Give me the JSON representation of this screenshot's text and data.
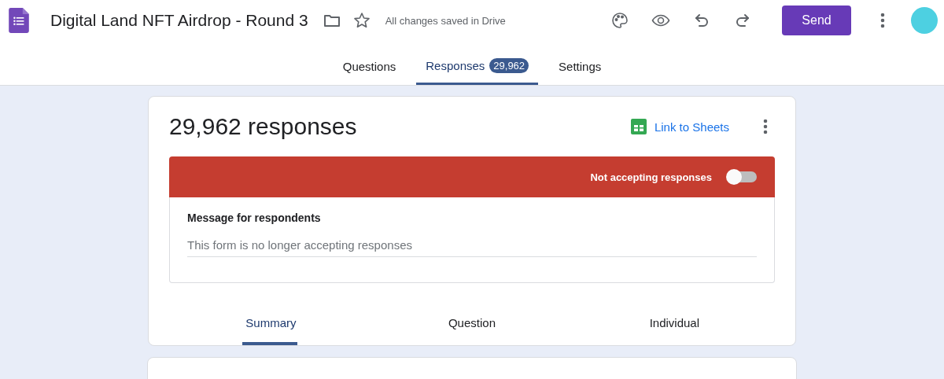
{
  "header": {
    "title": "Digital Land NFT Airdrop - Round 3",
    "save_status": "All changes saved in Drive",
    "send_label": "Send"
  },
  "tabs": [
    {
      "label": "Questions",
      "selected": false
    },
    {
      "label": "Responses",
      "selected": true,
      "badge": "29,962"
    },
    {
      "label": "Settings",
      "selected": false
    }
  ],
  "responses_card": {
    "title": "29,962 responses",
    "link_label": "Link to Sheets",
    "accepting": false,
    "accepting_label": "Not accepting responses",
    "message_label": "Message for respondents",
    "message_value": "This form is no longer accepting responses"
  },
  "view_tabs": [
    {
      "label": "Summary",
      "selected": true
    },
    {
      "label": "Question",
      "selected": false
    },
    {
      "label": "Individual",
      "selected": false
    }
  ]
}
